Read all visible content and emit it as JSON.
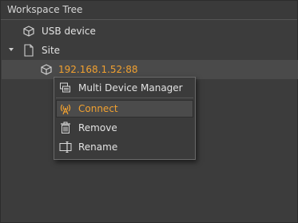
{
  "panel": {
    "title": "Workspace Tree"
  },
  "tree": {
    "items": [
      {
        "label": "USB device",
        "icon": "usb-device-icon"
      },
      {
        "label": "Site",
        "icon": "site-page-icon",
        "expanded": true
      },
      {
        "label": "192.168.1.52:88",
        "icon": "device-icon",
        "selected": true
      }
    ]
  },
  "context_menu": {
    "items": [
      {
        "label": "Multi Device Manager",
        "icon": "multi-device-manager-icon"
      },
      {
        "label": "Connect",
        "icon": "connect-antenna-icon",
        "highlighted": true
      },
      {
        "label": "Remove",
        "icon": "trash-icon"
      },
      {
        "label": "Rename",
        "icon": "rename-icon"
      }
    ]
  },
  "colors": {
    "background": "#3c3c3c",
    "accent_orange": "#f0a030",
    "text": "#e2e2e2"
  }
}
